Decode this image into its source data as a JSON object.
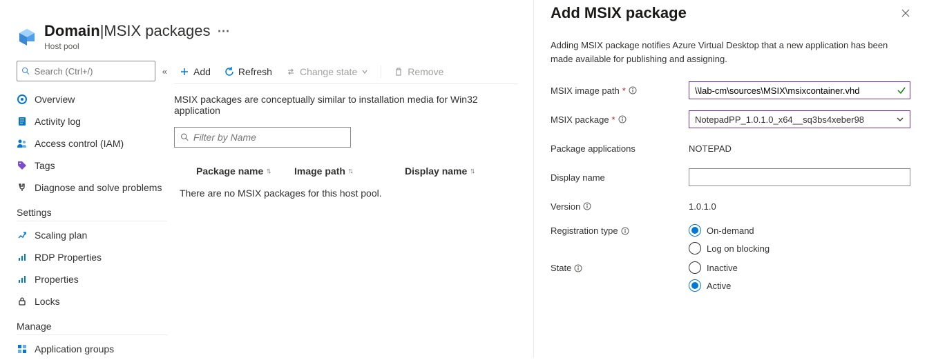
{
  "header": {
    "title_strong": "Domain",
    "title_sep": " | ",
    "title_rest": "MSIX packages",
    "subtitle": "Host pool"
  },
  "sidebar": {
    "search_placeholder": "Search (Ctrl+/)",
    "items_top": [
      {
        "label": "Overview"
      },
      {
        "label": "Activity log"
      },
      {
        "label": "Access control (IAM)"
      },
      {
        "label": "Tags"
      },
      {
        "label": "Diagnose and solve problems"
      }
    ],
    "section_settings": "Settings",
    "items_settings": [
      {
        "label": "Scaling plan"
      },
      {
        "label": "RDP Properties"
      },
      {
        "label": "Properties"
      },
      {
        "label": "Locks"
      }
    ],
    "section_manage": "Manage",
    "items_manage": [
      {
        "label": "Application groups"
      }
    ]
  },
  "toolbar": {
    "add": "Add",
    "refresh": "Refresh",
    "change_state": "Change state",
    "remove": "Remove"
  },
  "main": {
    "description": "MSIX packages are conceptually similar to installation media for Win32 application",
    "filter_placeholder": "Filter by Name",
    "columns": {
      "package_name": "Package name",
      "image_path": "Image path",
      "display_name": "Display name"
    },
    "empty_text": "There are no MSIX packages for this host pool."
  },
  "panel": {
    "title": "Add MSIX package",
    "description": "Adding MSIX package notifies Azure Virtual Desktop that a new application has been made available for publishing and assigning.",
    "labels": {
      "image_path": "MSIX image path",
      "package": "MSIX package",
      "apps": "Package applications",
      "display_name": "Display name",
      "version": "Version",
      "reg_type": "Registration type",
      "state": "State"
    },
    "values": {
      "image_path": "\\\\lab-cm\\sources\\MSIX\\msixcontainer.vhd",
      "package": "NotepadPP_1.0.1.0_x64__sq3bs4xeber98",
      "apps": "NOTEPAD",
      "display_name": "",
      "version": "1.0.1.0"
    },
    "reg_options": {
      "on_demand": "On-demand",
      "log_on": "Log on blocking"
    },
    "reg_selected": "on_demand",
    "state_options": {
      "inactive": "Inactive",
      "active": "Active"
    },
    "state_selected": "active"
  }
}
